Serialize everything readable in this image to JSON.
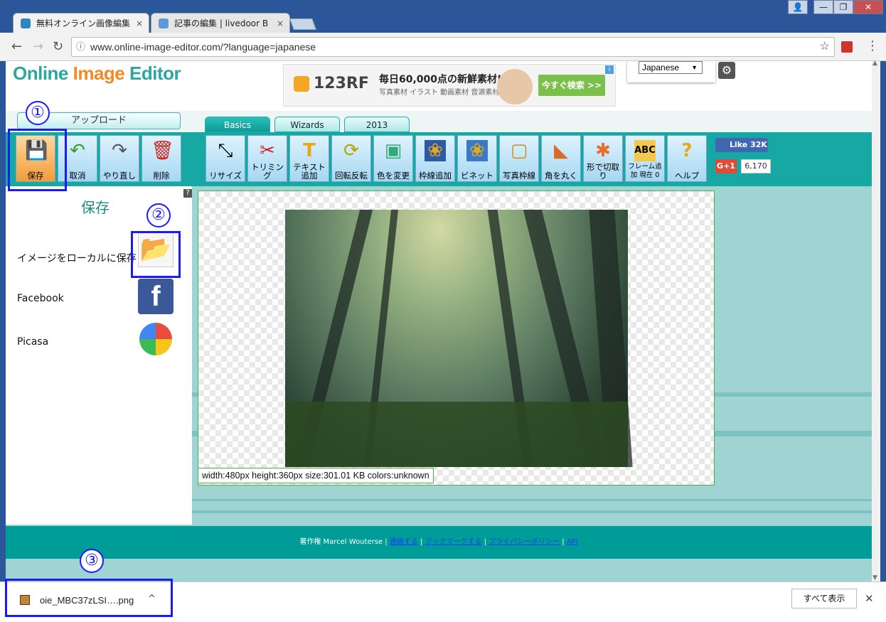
{
  "browser": {
    "tabs": [
      {
        "label": "無料オンライン画像編集",
        "close": "×"
      },
      {
        "label": "記事の編集 | livedoor B",
        "close": "×"
      }
    ],
    "url": "www.online-image-editor.com/?language=japanese",
    "window_controls": [
      "👤",
      "—",
      "❐",
      "✕"
    ],
    "nav": {
      "back": "←",
      "forward": "→",
      "reload": "↻",
      "star": "☆",
      "menu": "⋮"
    }
  },
  "header": {
    "logo_part1": "Online ",
    "logo_part2": "Image",
    "logo_part3": " Editor",
    "ad": {
      "brand": "123RF",
      "headline": "毎日60,000点の新鮮素材!",
      "sub": "写真素材 イラスト 動画素材 音源素材",
      "button": "今すぐ検索 >>",
      "badge": "i"
    },
    "language": "Japanese",
    "language_arrow": "▼",
    "settings": "⚙"
  },
  "upload_button": "アップロード",
  "main_tabs": [
    "Basics",
    "Wizards",
    "2013"
  ],
  "toolbar": [
    {
      "label": "保存",
      "icon": "💾"
    },
    {
      "label": "取消",
      "icon": "↶"
    },
    {
      "label": "やり直し",
      "icon": "↷"
    },
    {
      "label": "削除",
      "icon": "🗑"
    },
    {
      "label": "リサイズ",
      "icon": "⤡"
    },
    {
      "label": "トリミング",
      "icon": "✂"
    },
    {
      "label": "テキスト追加",
      "icon": "T"
    },
    {
      "label": "回転反転",
      "icon": "⟳"
    },
    {
      "label": "色を変更",
      "icon": "▣"
    },
    {
      "label": "枠線追加",
      "icon": "❀"
    },
    {
      "label": "ビネット",
      "icon": "❀"
    },
    {
      "label": "写真枠線",
      "icon": "▢"
    },
    {
      "label": "角を丸く",
      "icon": "◣"
    },
    {
      "label": "形で切取り",
      "icon": "✱"
    },
    {
      "label": "フレーム追加 現在 0",
      "icon": "ABC"
    },
    {
      "label": "ヘルプ",
      "icon": "?"
    }
  ],
  "social": {
    "like": "Like 32K",
    "gplus": "G+1",
    "gcount": "6,170"
  },
  "save_panel": {
    "help": "?",
    "title": "保存",
    "rows": [
      {
        "label": "イメージをローカルに保存",
        "icon": "📂"
      },
      {
        "label": "Facebook",
        "icon": "f"
      },
      {
        "label": "Picasa",
        "icon": "◕"
      }
    ]
  },
  "image_info": "width:480px  height:360px  size:301.01 KB  colors:unknown",
  "footer": {
    "copyright": "著作権 Marcel Wouterse",
    "sep": " | ",
    "links": [
      "連絡する",
      "ブックマークする",
      "プライバシーポリシー",
      "API"
    ]
  },
  "download_bar": {
    "filename": "oie_MBC37zLSI….png",
    "chevron": "^",
    "show_all": "すべて表示",
    "close": "✕"
  },
  "annotations": [
    "①",
    "②",
    "③"
  ],
  "colors": {
    "accent": "#009c97",
    "highlight": "#1a1aff",
    "logo_orange": "#f08a24",
    "logo_teal": "#2ea6a0"
  }
}
